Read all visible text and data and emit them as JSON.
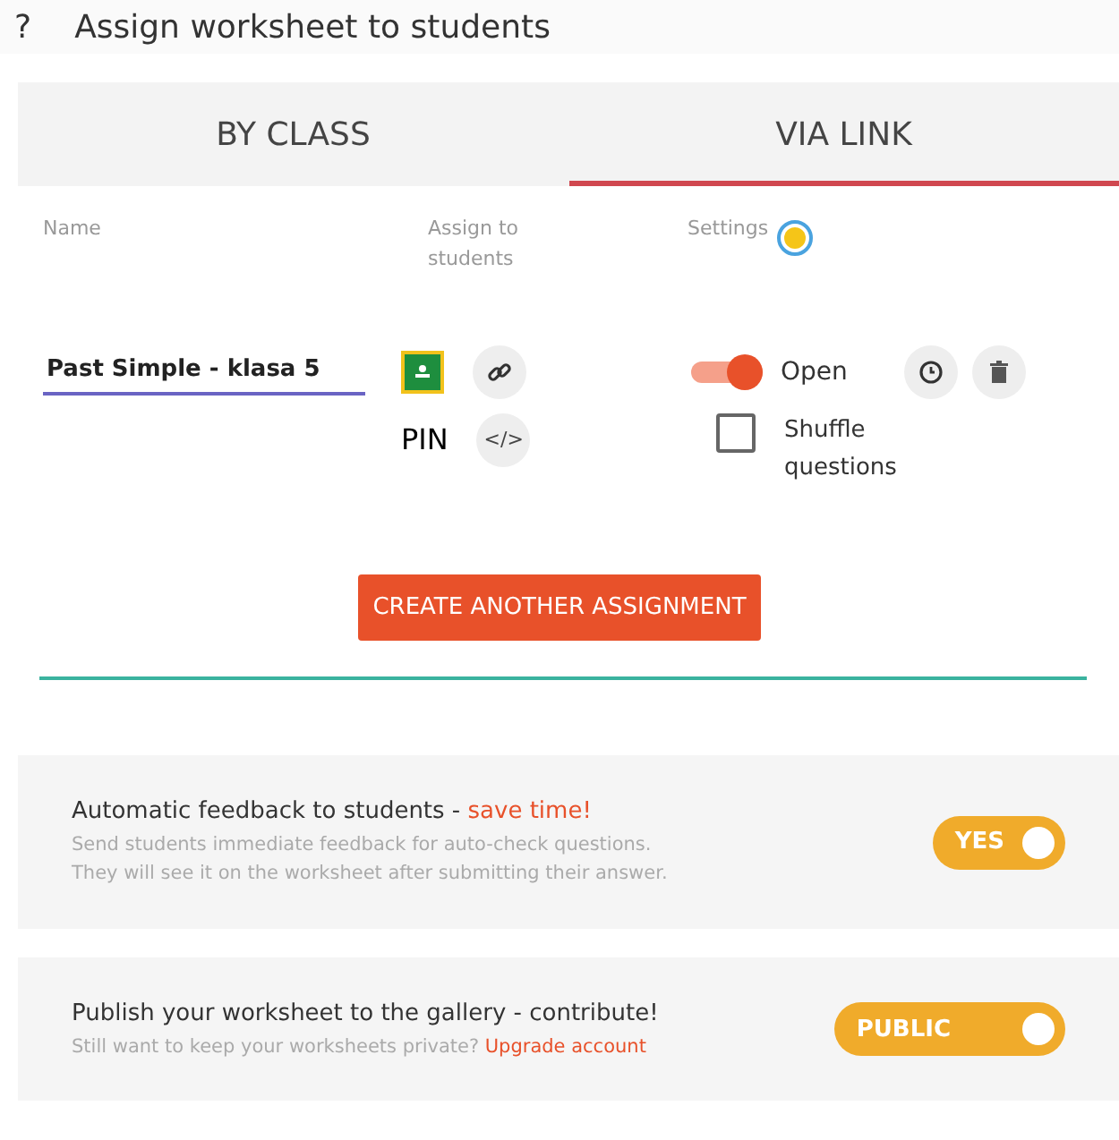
{
  "header": {
    "icon_text": "?",
    "title": "Assign worksheet to students"
  },
  "tabs": [
    {
      "label": "BY CLASS",
      "selected": false
    },
    {
      "label": "VIA LINK",
      "selected": true
    }
  ],
  "columns": [
    "Name",
    "Assign to students",
    "Settings"
  ],
  "assignment": {
    "name": "Past Simple - klasa 5",
    "pin": "PIN",
    "embed": "</>",
    "open": {
      "label": "Open",
      "on": true
    },
    "shuffle": {
      "label": "Shuffle questions",
      "checked": false
    }
  },
  "create_button": "CREATE ANOTHER ASSIGNMENT",
  "options": [
    {
      "title": "Automatic feedback to students - ",
      "highlight": "save time!",
      "description": "Send students immediate feedback for auto-check questions.\nThey will see it on the worksheet after submitting their answer.",
      "toggle": {
        "label": "YES",
        "on": true
      }
    },
    {
      "title": "Publish your worksheet to the gallery - contribute!",
      "description": "Still want to keep your worksheets private? ",
      "link": "Upgrade account",
      "toggle": {
        "label": "PUBLIC",
        "on": true
      }
    }
  ]
}
